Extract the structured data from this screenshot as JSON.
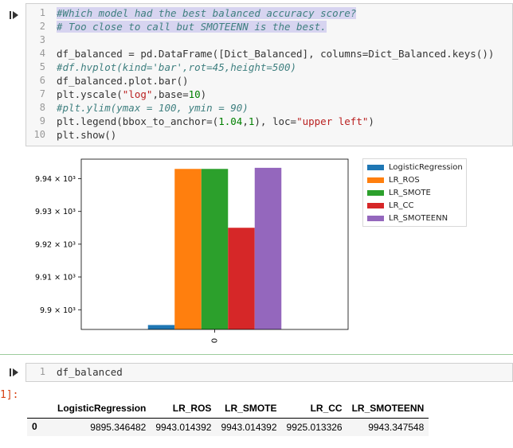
{
  "cells": [
    {
      "code_lines": [
        {
          "n": "1",
          "parts": [
            {
              "t": "#Which model had the best balanced accuracy score?",
              "c": "cm sel"
            }
          ]
        },
        {
          "n": "2",
          "parts": [
            {
              "t": "# Too close to call but SMOTEENN is the best.",
              "c": "cm sel"
            }
          ]
        },
        {
          "n": "3",
          "parts": []
        },
        {
          "n": "4",
          "parts": [
            {
              "t": "df_balanced = pd.DataFrame([Dict_Balanced], columns=Dict_Balanced.keys())",
              "c": ""
            }
          ]
        },
        {
          "n": "5",
          "parts": [
            {
              "t": "#df.hvplot(kind='bar',rot=45,height=500)",
              "c": "cm"
            }
          ]
        },
        {
          "n": "6",
          "parts": [
            {
              "t": "df_balanced.plot.bar()",
              "c": ""
            }
          ]
        },
        {
          "n": "7",
          "parts": [
            {
              "t": "plt.yscale(",
              "c": ""
            },
            {
              "t": "\"log\"",
              "c": "st"
            },
            {
              "t": ",base=",
              "c": ""
            },
            {
              "t": "10",
              "c": "nu"
            },
            {
              "t": ")",
              "c": ""
            }
          ]
        },
        {
          "n": "8",
          "parts": [
            {
              "t": "#plt.ylim(ymax = 100, ymin = 90)",
              "c": "cm"
            }
          ]
        },
        {
          "n": "9",
          "parts": [
            {
              "t": "plt.legend(bbox_to_anchor=(",
              "c": ""
            },
            {
              "t": "1.04",
              "c": "nu"
            },
            {
              "t": ",",
              "c": ""
            },
            {
              "t": "1",
              "c": "nu"
            },
            {
              "t": "), loc=",
              "c": ""
            },
            {
              "t": "\"upper left\"",
              "c": "st"
            },
            {
              "t": ")",
              "c": ""
            }
          ]
        },
        {
          "n": "10",
          "parts": [
            {
              "t": "plt.show()",
              "c": ""
            }
          ]
        }
      ]
    },
    {
      "code_lines": [
        {
          "n": "1",
          "parts": [
            {
              "t": "df_balanced",
              "c": ""
            }
          ]
        }
      ],
      "out_prompt": "1]:"
    }
  ],
  "chart_data": {
    "type": "bar",
    "categories": [
      "0"
    ],
    "yscale": "log",
    "ylim": [
      9894,
      9946
    ],
    "series": [
      {
        "name": "LogisticRegression",
        "values": [
          9895.346482
        ],
        "color": "#1f77b4"
      },
      {
        "name": "LR_ROS",
        "values": [
          9943.014392
        ],
        "color": "#ff7f0e"
      },
      {
        "name": "LR_SMOTE",
        "values": [
          9943.014392
        ],
        "color": "#2ca02c"
      },
      {
        "name": "LR_CC",
        "values": [
          9925.013326
        ],
        "color": "#d62728"
      },
      {
        "name": "LR_SMOTEENN",
        "values": [
          9943.347548
        ],
        "color": "#9467bd"
      }
    ],
    "yticks": [
      9900,
      9910,
      9920,
      9930,
      9940
    ],
    "ytick_labels": [
      "9.9 × 10³",
      "9.91 × 10³",
      "9.92 × 10³",
      "9.93 × 10³",
      "9.94 × 10³"
    ],
    "legend_location": "outside upper left"
  },
  "dataframe": {
    "columns": [
      "LogisticRegression",
      "LR_ROS",
      "LR_SMOTE",
      "LR_CC",
      "LR_SMOTEENN"
    ],
    "rows": [
      {
        "index": "0",
        "values": [
          "9895.346482",
          "9943.014392",
          "9943.014392",
          "9925.013326",
          "9943.347548"
        ]
      }
    ]
  }
}
